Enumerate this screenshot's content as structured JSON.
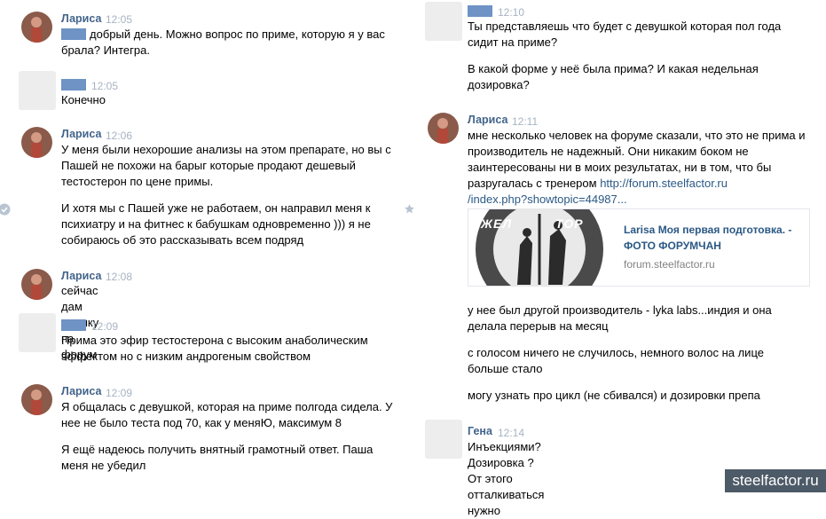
{
  "messages": [
    {
      "name": "Лариса",
      "time": "12:05",
      "lines": [
        "добрый день. Можно вопрос по приме, которую я у вас",
        "брала? Интегра."
      ]
    },
    {
      "name": "",
      "time": "12:05",
      "lines": [
        "Конечно"
      ]
    },
    {
      "name": "Лариса",
      "time": "12:06",
      "p1": [
        "У меня были нехорошие анализы на этом препарате, но вы с",
        "Пашей не похожи на барыг которые продают дешевый",
        "тестостерон по цене примы."
      ],
      "p2": [
        "И хотя мы с Пашей уже не работаем, он направил меня к",
        "психиатру и на фитнес к бабушкам одновременно ))) я не",
        "собираюсь об это рассказывать всем подряд"
      ]
    },
    {
      "name": "Лариса",
      "time": "12:08",
      "lines": [
        "сейчас дам ссылку на форум"
      ]
    },
    {
      "name": "",
      "time": "12:09",
      "lines": [
        "Прима это эфир тестостерона с высоким анаболическим",
        "эффектом но с низким андрогеным свойством"
      ]
    },
    {
      "name": "Лариса",
      "time": "12:09",
      "p1": [
        "Я общалась с девушкой, которая на приме полгода сидела. У",
        "нее не было теста под 70, как у меняЮ, максимум 8"
      ],
      "p2": [
        "Я ещё надеюсь получить внятный грамотный ответ. Паша",
        "меня не убедил"
      ]
    },
    {
      "name": "",
      "time": "12:10",
      "p1": [
        "Ты представляешь что будет с девушкой которая пол года",
        "сидит на приме?"
      ],
      "p2": [
        "В какой форме у неё была прима? И какая недельная",
        "дозировка?"
      ]
    },
    {
      "name": "Лариса",
      "time": "12:11",
      "lines": [
        "мне несколько человек на форуме сказали, что это не прима и",
        "производитель не надежный. Они никаким боком не",
        "заинтересованы ни в моих результатах, ни в том, что бы"
      ],
      "line4_prefix": "разругалась с тренером ",
      "link1": "http://forum.steelfactor.ru",
      "link2": "/index.php?showtopic=44987..."
    },
    {
      "name": "Гена",
      "time": "12:14",
      "lines": [
        "Инъекциями? Дозировка ? От этого отталкиваться нужно"
      ]
    }
  ],
  "card": {
    "title1": "Larisa Моя первая подготовка. -",
    "title2": "ФОТО ФОРУМЧАН",
    "domain": "forum.steelfactor.ru",
    "logo_text": "ЖЕЛ          ТОР"
  },
  "after_card": {
    "p1": [
      "у нее был другой производитель - lyka labs...индия и она",
      "делала перерыв на месяц"
    ],
    "p2": [
      "с голосом ничего не случилось, немного волос на лице",
      "больше стало"
    ],
    "p3": [
      "могу узнать про цикл (не сбивался) и дозировки препа"
    ]
  },
  "watermark": "steelfactor.ru",
  "colors": {
    "name": "#42648b",
    "time": "#a6b3c2",
    "link": "#2a5885",
    "redact": "#6e93c4",
    "watermark_bg": "#4d5a67"
  },
  "icons": [
    "check-circle-icon",
    "star-icon"
  ]
}
